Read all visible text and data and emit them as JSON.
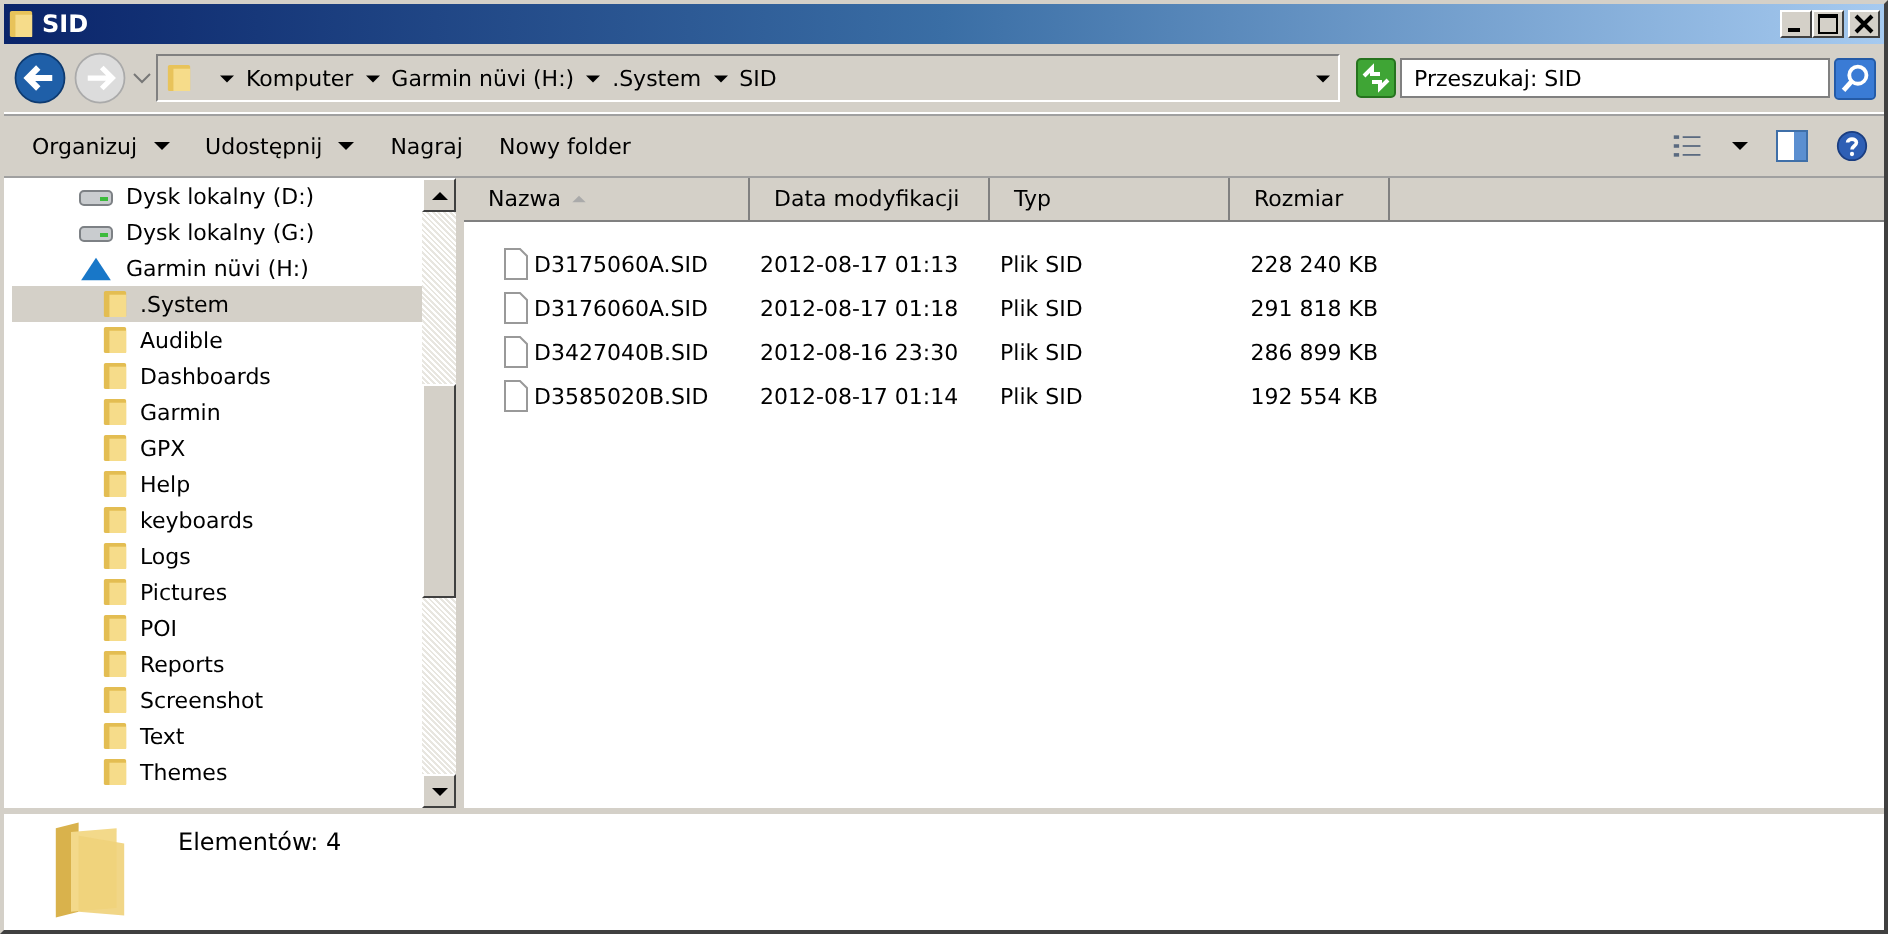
{
  "window": {
    "title": "SID"
  },
  "address_bar": {
    "breadcrumbs": [
      "Komputer",
      "Garmin nüvi (H:)",
      ".System",
      "SID"
    ]
  },
  "search": {
    "placeholder": "Przeszukaj: SID"
  },
  "toolbar": {
    "buttons": [
      {
        "label": "Organizuj",
        "dropdown": true
      },
      {
        "label": "Udostępnij",
        "dropdown": true
      },
      {
        "label": "Nagraj",
        "dropdown": false
      },
      {
        "label": "Nowy folder",
        "dropdown": false
      }
    ]
  },
  "sidebar": {
    "items": [
      {
        "label": "Dysk lokalny (D:)",
        "kind": "drive",
        "selected": false
      },
      {
        "label": "Dysk lokalny (G:)",
        "kind": "drive",
        "selected": false
      },
      {
        "label": "Garmin nüvi (H:)",
        "kind": "device",
        "selected": false,
        "children": [
          {
            "label": ".System",
            "kind": "folder",
            "selected": true
          },
          {
            "label": "Audible",
            "kind": "folder",
            "selected": false
          },
          {
            "label": "Dashboards",
            "kind": "folder",
            "selected": false
          },
          {
            "label": "Garmin",
            "kind": "folder",
            "selected": false
          },
          {
            "label": "GPX",
            "kind": "folder",
            "selected": false
          },
          {
            "label": "Help",
            "kind": "folder",
            "selected": false
          },
          {
            "label": "keyboards",
            "kind": "folder",
            "selected": false
          },
          {
            "label": "Logs",
            "kind": "folder",
            "selected": false
          },
          {
            "label": "Pictures",
            "kind": "folder",
            "selected": false
          },
          {
            "label": "POI",
            "kind": "folder",
            "selected": false
          },
          {
            "label": "Reports",
            "kind": "folder",
            "selected": false
          },
          {
            "label": "Screenshot",
            "kind": "folder",
            "selected": false
          },
          {
            "label": "Text",
            "kind": "folder",
            "selected": false
          },
          {
            "label": "Themes",
            "kind": "folder",
            "selected": false
          }
        ]
      }
    ]
  },
  "table": {
    "columns": [
      {
        "label": "Nazwa",
        "sorted": true
      },
      {
        "label": "Data modyfikacji",
        "sorted": false
      },
      {
        "label": "Typ",
        "sorted": false
      },
      {
        "label": "Rozmiar",
        "sorted": false
      }
    ],
    "rows": [
      [
        "D3175060A.SID",
        "2012-08-17 01:13",
        "Plik SID",
        "228 240 KB"
      ],
      [
        "D3176060A.SID",
        "2012-08-17 01:18",
        "Plik SID",
        "291 818 KB"
      ],
      [
        "D3427040B.SID",
        "2012-08-16 23:30",
        "Plik SID",
        "286 899 KB"
      ],
      [
        "D3585020B.SID",
        "2012-08-17 01:14",
        "Plik SID",
        "192 554 KB"
      ]
    ]
  },
  "details_pane": {
    "text": "Elementów: 4"
  }
}
